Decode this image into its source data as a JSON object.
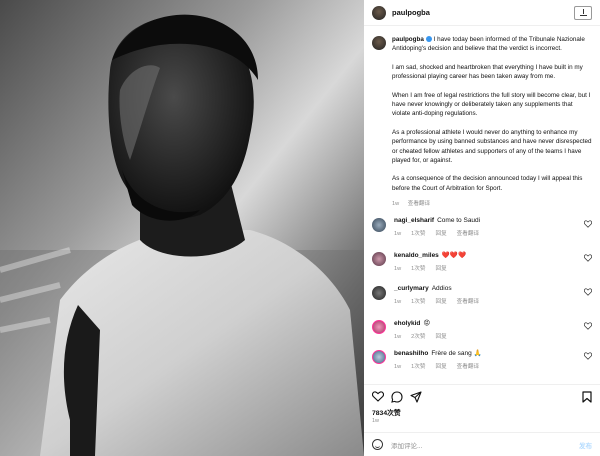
{
  "post": {
    "username": "paulpogba",
    "caption": {
      "p1": "I have today been informed of the Tribunale Nazionale Antidoping's decision and believe that the verdict is incorrect.",
      "p2": "I am sad, shocked and heartbroken that everything I have built in my professional playing career has been taken away from me.",
      "p3": "When I am free of legal restrictions the full story will become clear, but I have never knowingly or deliberately taken any supplements that violate anti-doping regulations.",
      "p4": "As a professional athlete I would never do anything to enhance my performance by using banned substances and have never disrespected or cheated fellow athletes and supporters of any of the teams I have played for, or against.",
      "p5": "As a consequence of the decision announced today I will appeal this before the Court of Arbitration for Sport.",
      "time": "1w",
      "see_translation": "查看翻译"
    },
    "likes": "7834次赞",
    "date": "1w",
    "add_comment_placeholder": "添加评论...",
    "post_label": "发布"
  },
  "comments": [
    {
      "user": "nagi_elsharif",
      "text": "Come to Saudi",
      "time": "1w",
      "likes": "1次赞",
      "reply": "回复",
      "translate": "查看翻译"
    },
    {
      "user": "kenaldo_miles",
      "text": "❤️❤️❤️",
      "time": "1w",
      "likes": "1次赞",
      "reply": "回复",
      "translate": ""
    },
    {
      "user": "_curlymary",
      "text": "Addios",
      "time": "1w",
      "likes": "1次赞",
      "reply": "回复",
      "translate": "查看翻译"
    },
    {
      "user": "eholykid",
      "text": "😡",
      "time": "1w",
      "likes": "2次赞",
      "reply": "回复",
      "translate": ""
    },
    {
      "user": "benashilho",
      "text": "Frère de sang 🙏",
      "time": "1w",
      "likes": "1次赞",
      "reply": "回复",
      "translate": "查看翻译"
    }
  ],
  "colors": {
    "verified": "#3897f0",
    "heart": "#ed4956"
  }
}
